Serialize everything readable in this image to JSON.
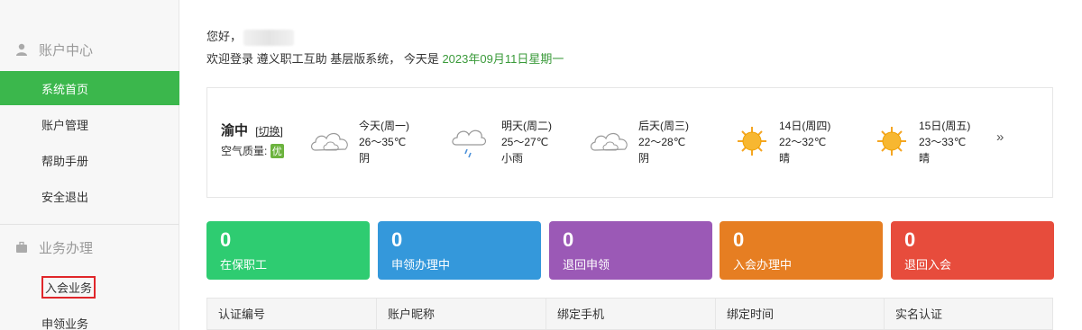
{
  "sidebar": {
    "section1": "账户中心",
    "items1": [
      "系统首页",
      "账户管理",
      "帮助手册",
      "安全退出"
    ],
    "section2": "业务办理",
    "items2": [
      "入会业务",
      "申领业务"
    ]
  },
  "greeting": {
    "hello": "您好，",
    "welcome": "欢迎登录 遵义职工互助 基层版系统，  今天是 ",
    "date": "2023年09月11日星期一"
  },
  "weather": {
    "city": "渝中",
    "switch": "切换",
    "aqi_label": "空气质量:",
    "aqi_value": "优",
    "days": [
      {
        "name": "今天(周一)",
        "temp": "26～35℃",
        "desc": "阴",
        "icon": "cloudy-icon"
      },
      {
        "name": "明天(周二)",
        "temp": "25～27℃",
        "desc": "小雨",
        "icon": "light-rain-icon"
      },
      {
        "name": "后天(周三)",
        "temp": "22～28℃",
        "desc": "阴",
        "icon": "cloudy-icon"
      },
      {
        "name": "14日(周四)",
        "temp": "22～32℃",
        "desc": "晴",
        "icon": "sunny-icon"
      },
      {
        "name": "15日(周五)",
        "temp": "23～33℃",
        "desc": "晴",
        "icon": "sunny-icon"
      }
    ],
    "more": "»"
  },
  "cards": [
    {
      "num": "0",
      "label": "在保职工",
      "color": "#2ecc71"
    },
    {
      "num": "0",
      "label": "申领办理中",
      "color": "#3498db"
    },
    {
      "num": "0",
      "label": "退回申领",
      "color": "#9b59b6"
    },
    {
      "num": "0",
      "label": "入会办理中",
      "color": "#e67e22"
    },
    {
      "num": "0",
      "label": "退回入会",
      "color": "#e74c3c"
    }
  ],
  "table": {
    "headers": [
      "认证编号",
      "账户昵称",
      "绑定手机",
      "绑定时间",
      "实名认证"
    ]
  }
}
